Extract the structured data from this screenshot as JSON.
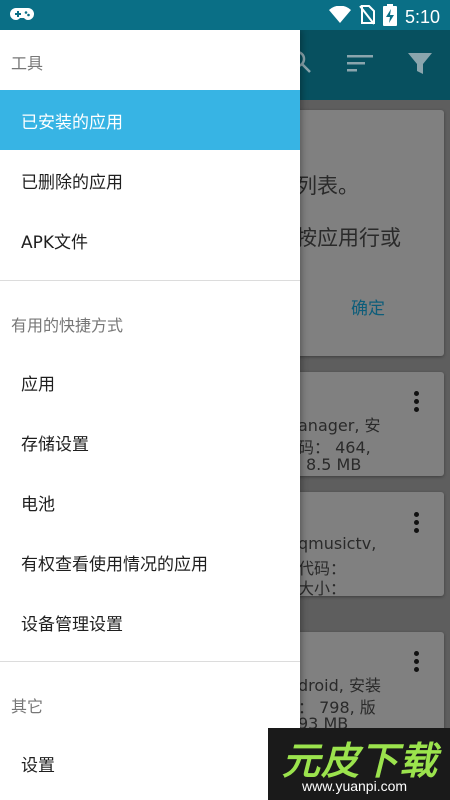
{
  "status_bar": {
    "time": "5:10",
    "icons": [
      "gamepad-icon",
      "wifi-icon",
      "no-sim-icon",
      "battery-charging-icon"
    ]
  },
  "toolbar": {
    "icons": [
      "search-icon",
      "sort-icon",
      "filter-icon"
    ]
  },
  "background": {
    "dialog": {
      "line1": "列表。",
      "line2": "按应用行或",
      "ok": "确定"
    },
    "cards": [
      {
        "line1": "anager, 安",
        "line2": "码： 464,",
        "line3": "8.5 MB"
      },
      {
        "line1": "qmusictv,",
        "line2": "代码：",
        "line3": "大小："
      },
      {
        "line1": "droid, 安装",
        "line2": "： 798, 版",
        "line3": "93 MB"
      }
    ]
  },
  "drawer": {
    "sections": [
      {
        "label": "工具",
        "items": [
          "已安装的应用",
          "已删除的应用",
          "APK文件"
        ]
      },
      {
        "label": "有用的快捷方式",
        "items": [
          "应用",
          "存储设置",
          "电池",
          "有权查看使用情况的应用",
          "设备管理设置"
        ]
      },
      {
        "label": "其它",
        "items": [
          "设置"
        ]
      }
    ],
    "active_item": "已安装的应用",
    "accent_color": "#37b4e4"
  },
  "watermark": {
    "logo": "元皮下载",
    "url": "www.yuanpi.com"
  }
}
